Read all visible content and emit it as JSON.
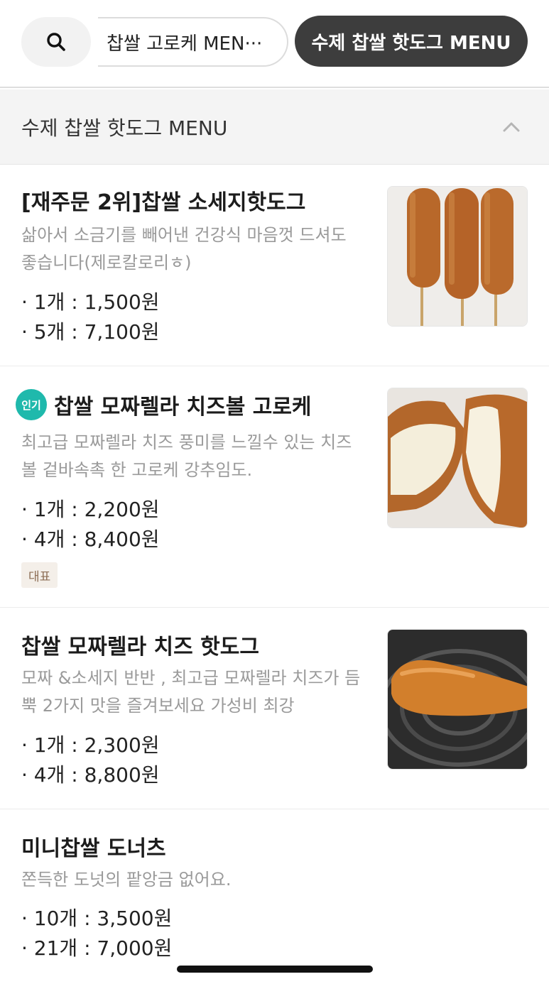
{
  "tabs": {
    "search_icon": "search-icon",
    "prev_tab_label": "찹쌀 고로케  MEN···",
    "active_tab_label": "수제 찹쌀 핫도그 MENU"
  },
  "section": {
    "title": "수제 찹쌀 핫도그 MENU",
    "toggle_icon": "chevron-up-icon"
  },
  "items": [
    {
      "name": "[재주문 2위]찹쌀 소세지핫도그",
      "desc_line1": "삶아서 소금기를 빼어낸 건강식 마음껏 드셔도",
      "desc_line2": "좋습니다(제로칼로리ㅎ)",
      "prices": [
        "· 1개 : 1,500원",
        "· 5개 : 7,100원"
      ],
      "image": "three-rice-hotdogs-on-sticks"
    },
    {
      "badge": "인기",
      "name": "찹쌀 모짜렐라 치즈볼 고로케",
      "desc_line1": "최고급 모짜렐라 치즈 풍미를 느낄수 있는 치즈",
      "desc_line2": "볼 겉바속촉  한  고로케 강추임도.",
      "prices": [
        "· 1개 : 2,200원",
        "· 4개 : 8,400원"
      ],
      "tag": "대표",
      "image": "cheese-ball-croquette-cut"
    },
    {
      "name": "찹쌀 모짜렐라 치즈 핫도그",
      "desc_line1": "모짜 &소세지 반반 , 최고급 모짜렐라 치즈가 듬",
      "desc_line2": "뿍 2가지 맛을 즐겨보세요 가성비 최강",
      "prices": [
        "· 1개 : 2,300원",
        "· 4개 : 8,800원"
      ],
      "image": "cheese-hotdog-on-dark-plate"
    },
    {
      "name": "미니찹쌀 도너츠",
      "desc_line1": "쫀득한 도넛의 팥앙금 없어요.",
      "prices": [
        "· 10개 : 3,500원",
        "· 21개 : 7,000원"
      ]
    }
  ],
  "colors": {
    "active_tab_bg": "#3d3d3d",
    "popular_badge": "#1fb9ac",
    "tag_bg": "#f4efe9",
    "tag_text": "#8d6e55",
    "desc_text": "#9a9a9a"
  }
}
